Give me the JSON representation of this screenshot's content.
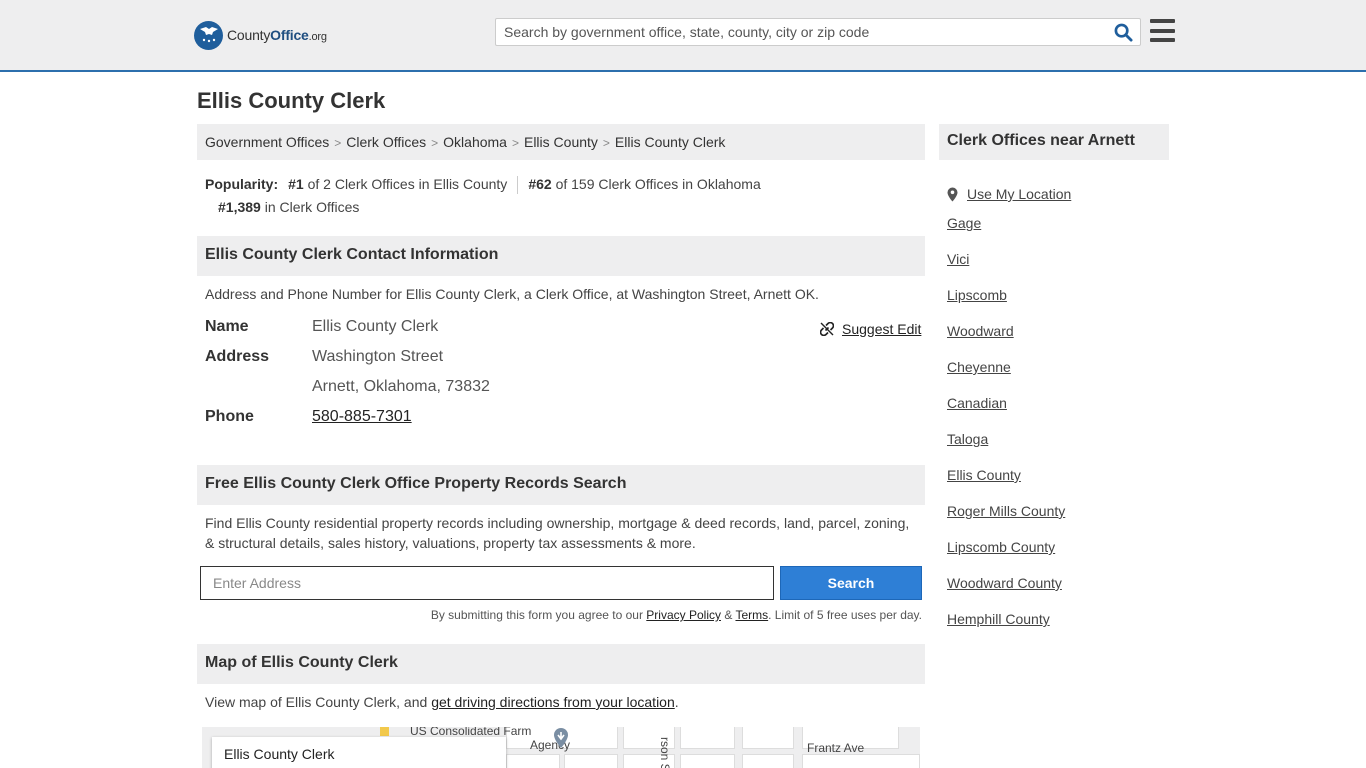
{
  "header": {
    "logo": {
      "name_a": "County",
      "name_b": "Office",
      "tld": ".org"
    },
    "search_placeholder": "Search by government office, state, county, city or zip code"
  },
  "page_title": "Ellis County Clerk",
  "breadcrumb": [
    "Government Offices",
    "Clerk Offices",
    "Oklahoma",
    "Ellis County",
    "Ellis County Clerk"
  ],
  "popularity": {
    "label": "Popularity:",
    "rank1": "#1",
    "rank1_text": "of 2 Clerk Offices in Ellis County",
    "rank2": "#62",
    "rank2_text": "of 159 Clerk Offices in Oklahoma",
    "rank3": "#1,389",
    "rank3_text": "in Clerk Offices"
  },
  "contact": {
    "heading": "Ellis County Clerk Contact Information",
    "description": "Address and Phone Number for Ellis County Clerk, a Clerk Office, at Washington Street, Arnett OK.",
    "suggest_edit": "Suggest Edit",
    "name_label": "Name",
    "name_value": "Ellis County Clerk",
    "address_label": "Address",
    "address_line1": "Washington Street",
    "address_line2": "Arnett, Oklahoma, 73832",
    "phone_label": "Phone",
    "phone_value": "580-885-7301"
  },
  "property": {
    "heading": "Free Ellis County Clerk Office Property Records Search",
    "description": "Find Ellis County residential property records including ownership, mortgage & deed records, land, parcel, zoning, & structural details, sales history, valuations, property tax assessments & more.",
    "input_placeholder": "Enter Address",
    "button": "Search",
    "terms_prefix": "By submitting this form you agree to our",
    "privacy": "Privacy Policy",
    "amp": "&",
    "terms": "Terms",
    "terms_suffix": ". Limit of 5 free uses per day."
  },
  "map": {
    "heading": "Map of Ellis County Clerk",
    "description_prefix": "View map of Ellis County Clerk, and",
    "directions_link": "get driving directions from your location",
    "description_suffix": ".",
    "label": "Ellis County Clerk",
    "poi_line1": "US Consolidated Farm",
    "poi_line2": "Agency",
    "street1": "Frantz Ave",
    "street2": "rson St"
  },
  "sidebar": {
    "heading": "Clerk Offices near Arnett",
    "use_location": "Use My Location",
    "items": [
      "Gage",
      "Vici",
      "Lipscomb",
      "Woodward",
      "Cheyenne",
      "Canadian",
      "Taloga",
      "Ellis County",
      "Roger Mills County",
      "Lipscomb County",
      "Woodward County",
      "Hemphill County"
    ]
  },
  "colors": {
    "accent": "#2e7fd6",
    "header_border": "#2c6fad",
    "panel": "#eeeeef"
  }
}
